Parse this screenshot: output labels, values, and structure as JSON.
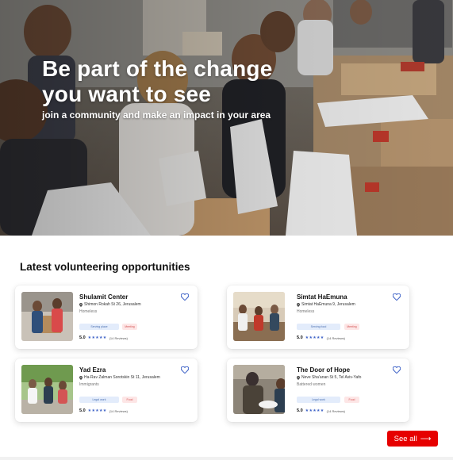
{
  "hero": {
    "title": "Be part of the change you want to see",
    "subtitle": "join a community and make an impact in your area"
  },
  "section": {
    "title": "Latest volunteering opportunities"
  },
  "cards": [
    {
      "name": "Shulamit Center",
      "address": "Shimon Rokah St 26, Jerusalem",
      "category": "Homeless",
      "tag_a": "Serving place",
      "tag_b": "Meeting",
      "score": "5.0",
      "stars": "★★★★★",
      "reviews": "(14 Reviews)"
    },
    {
      "name": "Simtat HaEmuna",
      "address": "Simtat HaEmuna 9, Jerusalem",
      "category": "Homeless",
      "tag_a": "Serving food",
      "tag_b": "Meeting",
      "score": "5.0",
      "stars": "★★★★★",
      "reviews": "(14 Reviews)"
    },
    {
      "name": "Yad Ezra",
      "address": "Ha-Rav Zalman Sorotskin St 11, Jerusalem",
      "category": "Immigrants",
      "tag_a": "Legal work",
      "tag_b": "Food",
      "score": "5.0",
      "stars": "★★★★★",
      "reviews": "(14 Reviews)"
    },
    {
      "name": "The Door of Hope",
      "address": "Neve Sha'anan St 5, Tel Aviv-Yafo",
      "category": "Battered women",
      "tag_a": "Legal work",
      "tag_b": "Food",
      "score": "5.0",
      "stars": "★★★★★",
      "reviews": "(14 Reviews)"
    }
  ],
  "see_all": {
    "label": "See all",
    "arrow": "⟶"
  },
  "colors": {
    "accent": "#e60000",
    "star": "#3f63c7",
    "tag_blue_bg": "#e3ecfb",
    "tag_red_bg": "#fde6e6"
  },
  "icons": [
    "location-pin-icon",
    "heart-icon",
    "arrow-right-icon"
  ]
}
